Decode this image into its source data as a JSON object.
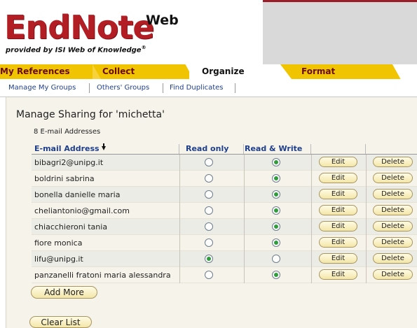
{
  "header": {
    "logo_main": "EndNote",
    "logo_web": "Web",
    "logo_sub": "provided by ISI Web of Knowledge",
    "logo_mark": "®"
  },
  "tabs": [
    {
      "label": "My References",
      "active": false
    },
    {
      "label": "Collect",
      "active": false
    },
    {
      "label": "Organize",
      "active": true
    },
    {
      "label": "Format",
      "active": false
    }
  ],
  "subnav": [
    {
      "label": "Manage My Groups"
    },
    {
      "label": "Others' Groups"
    },
    {
      "label": "Find Duplicates"
    }
  ],
  "page": {
    "title": "Manage Sharing for 'michetta'",
    "count": "8 E-mail Addresses"
  },
  "table": {
    "headers": {
      "email": "E-mail Address",
      "read_only": "Read only",
      "read_write": "Read & Write"
    },
    "sort_icon": "sort-down-arrow-icon",
    "edit_label": "Edit",
    "delete_label": "Delete",
    "rows": [
      {
        "email": "bibagri2@unipg.it",
        "access": "read_write"
      },
      {
        "email": "boldrini sabrina",
        "access": "read_write"
      },
      {
        "email": "bonella danielle maria",
        "access": "read_write"
      },
      {
        "email": "cheliantonio@gmail.com",
        "access": "read_write"
      },
      {
        "email": "chiacchieroni tania",
        "access": "read_write"
      },
      {
        "email": "fiore monica",
        "access": "read_write"
      },
      {
        "email": "lifu@unipg.it",
        "access": "read_only"
      },
      {
        "email": "panzanelli fratoni maria alessandra",
        "access": "read_write"
      }
    ]
  },
  "buttons": {
    "add_more": "Add More",
    "clear_list": "Clear List"
  },
  "colors": {
    "brand_red": "#b31e24",
    "tab_yellow": "#f0c400",
    "link_blue": "#1f3f8a",
    "radio_green": "#2e9e3a"
  }
}
